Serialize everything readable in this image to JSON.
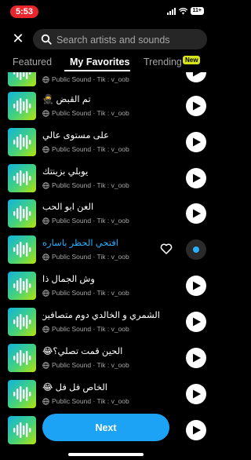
{
  "status_bar": {
    "time": "5:53",
    "battery": "11+"
  },
  "search": {
    "placeholder": "Search artists and sounds"
  },
  "tabs": [
    {
      "label": "Featured"
    },
    {
      "label": "My Favorites"
    },
    {
      "label": "Trending"
    }
  ],
  "trending_badge": "New",
  "colors": {
    "accent": "#1ca3f5",
    "active_title": "#2ab0ff",
    "time_pill": "#e8262d",
    "badge": "#d7e31b"
  },
  "sounds": [
    {
      "title": "",
      "subtitle": "Public Sound · Tik : v_oob",
      "active": false
    },
    {
      "title": "تم القبض 🥷",
      "subtitle": "Public Sound · Tik : v_oob",
      "active": false
    },
    {
      "title": "على مستوى عالي",
      "subtitle": "Public Sound · Tik : v_oob",
      "active": false
    },
    {
      "title": "يوبلي بزينتك",
      "subtitle": "Public Sound · Tik : v_oob",
      "active": false
    },
    {
      "title": "العن ابو الحب",
      "subtitle": "Public Sound · Tik : v_oob",
      "active": false
    },
    {
      "title": "افتحي الحظر باساره",
      "subtitle": "Public Sound · Tik : v_oob",
      "active": true
    },
    {
      "title": "وش الجمال ذا",
      "subtitle": "Public Sound · Tik : v_oob",
      "active": false
    },
    {
      "title": "الشمري و الخالدي دوم متصافين🫡",
      "subtitle": "Public Sound · Tik : v_oob",
      "active": false
    },
    {
      "title": "الحين قمت تصلي؟😂",
      "subtitle": "Public Sound · Tik : v_oob",
      "active": false
    },
    {
      "title": "الخاص فل فل 😂",
      "subtitle": "Public Sound · Tik : v_oob",
      "active": false
    },
    {
      "title": "",
      "subtitle": "",
      "active": false
    }
  ],
  "next_button": "Next"
}
